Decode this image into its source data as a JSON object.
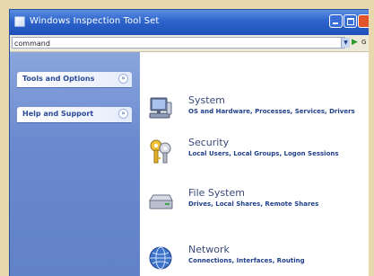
{
  "window": {
    "title": "Windows Inspection Tool Set"
  },
  "addressbar": {
    "command_value": "command",
    "go_label": "G"
  },
  "sidebar": {
    "panels": [
      {
        "label": "Tools and Options"
      },
      {
        "label": "Help and Support"
      }
    ]
  },
  "categories": [
    {
      "title": "System",
      "description": "OS and Hardware, Processes, Services, Drivers",
      "icon": "computer-icon"
    },
    {
      "title": "Security",
      "description": "Local Users, Local Groups, Logon Sessions",
      "icon": "keys-icon"
    },
    {
      "title": "File System",
      "description": "Drives, Local Shares, Remote Shares",
      "icon": "drive-icon"
    },
    {
      "title": "Network",
      "description": "Connections, Interfaces, Routing",
      "icon": "network-globe-icon"
    }
  ],
  "colors": {
    "titlebar": "#2d64cc",
    "sidebar": "#6b89cf",
    "link": "#1f3f8c",
    "frame": "#e7d9ad"
  }
}
